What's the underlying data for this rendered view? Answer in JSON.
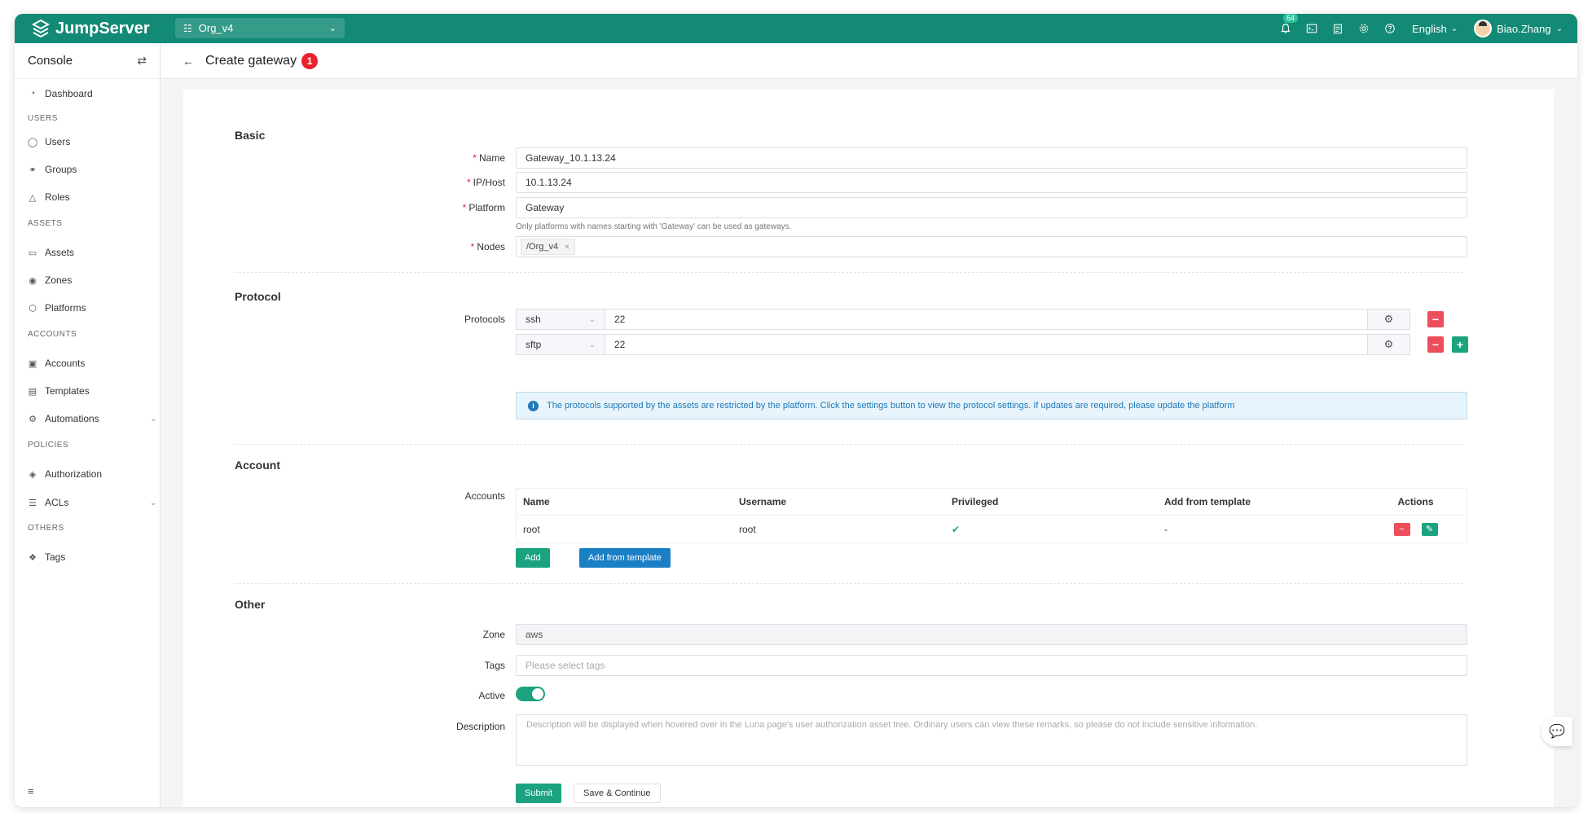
{
  "topbar": {
    "brand": "JumpServer",
    "org": "Org_v4",
    "notification_count": "64",
    "language": "English",
    "username": "Biao.Zhang",
    "colors": {
      "primary": "#138a75"
    }
  },
  "sidebar": {
    "title": "Console",
    "dashboard": "Dashboard",
    "sections": {
      "users": "USERS",
      "assets": "ASSETS",
      "accounts": "ACCOUNTS",
      "policies": "POLICIES",
      "others": "OTHERS"
    },
    "items": {
      "users": "Users",
      "groups": "Groups",
      "roles": "Roles",
      "assets": "Assets",
      "zones": "Zones",
      "platforms": "Platforms",
      "accounts": "Accounts",
      "templates": "Templates",
      "automations": "Automations",
      "authorization": "Authorization",
      "acls": "ACLs",
      "tags": "Tags"
    }
  },
  "header": {
    "title": "Create gateway",
    "step_badge": "1"
  },
  "form": {
    "basic": {
      "title": "Basic",
      "name_label": "Name",
      "name_value": "Gateway_10.1.13.24",
      "ip_label": "IP/Host",
      "ip_value": "10.1.13.24",
      "platform_label": "Platform",
      "platform_value": "Gateway",
      "platform_hint": "Only platforms with names starting with 'Gateway' can be used as gateways.",
      "nodes_label": "Nodes",
      "nodes_tag": "/Org_v4"
    },
    "protocol": {
      "title": "Protocol",
      "protocols_label": "Protocols",
      "rows": [
        {
          "name": "ssh",
          "port": "22"
        },
        {
          "name": "sftp",
          "port": "22"
        }
      ],
      "info": "The protocols supported by the assets are restricted by the platform. Click the settings button to view the protocol settings. If updates are required, please update the platform"
    },
    "account": {
      "title": "Account",
      "accounts_label": "Accounts",
      "columns": [
        "Name",
        "Username",
        "Privileged",
        "Add from template",
        "Actions"
      ],
      "rows": [
        {
          "name": "root",
          "username": "root",
          "template": "-"
        }
      ],
      "add_button": "Add",
      "add_template_button": "Add from template"
    },
    "other": {
      "title": "Other",
      "zone_label": "Zone",
      "zone_value": "aws",
      "tags_label": "Tags",
      "tags_placeholder": "Please select tags",
      "active_label": "Active",
      "description_label": "Description",
      "description_placeholder": "Description will be displayed when hovered over in the Luna page's user authorization asset tree. Ordinary users can view these remarks, so please do not include sensitive information."
    },
    "submit_button": "Submit",
    "save_continue_button": "Save & Continue"
  }
}
